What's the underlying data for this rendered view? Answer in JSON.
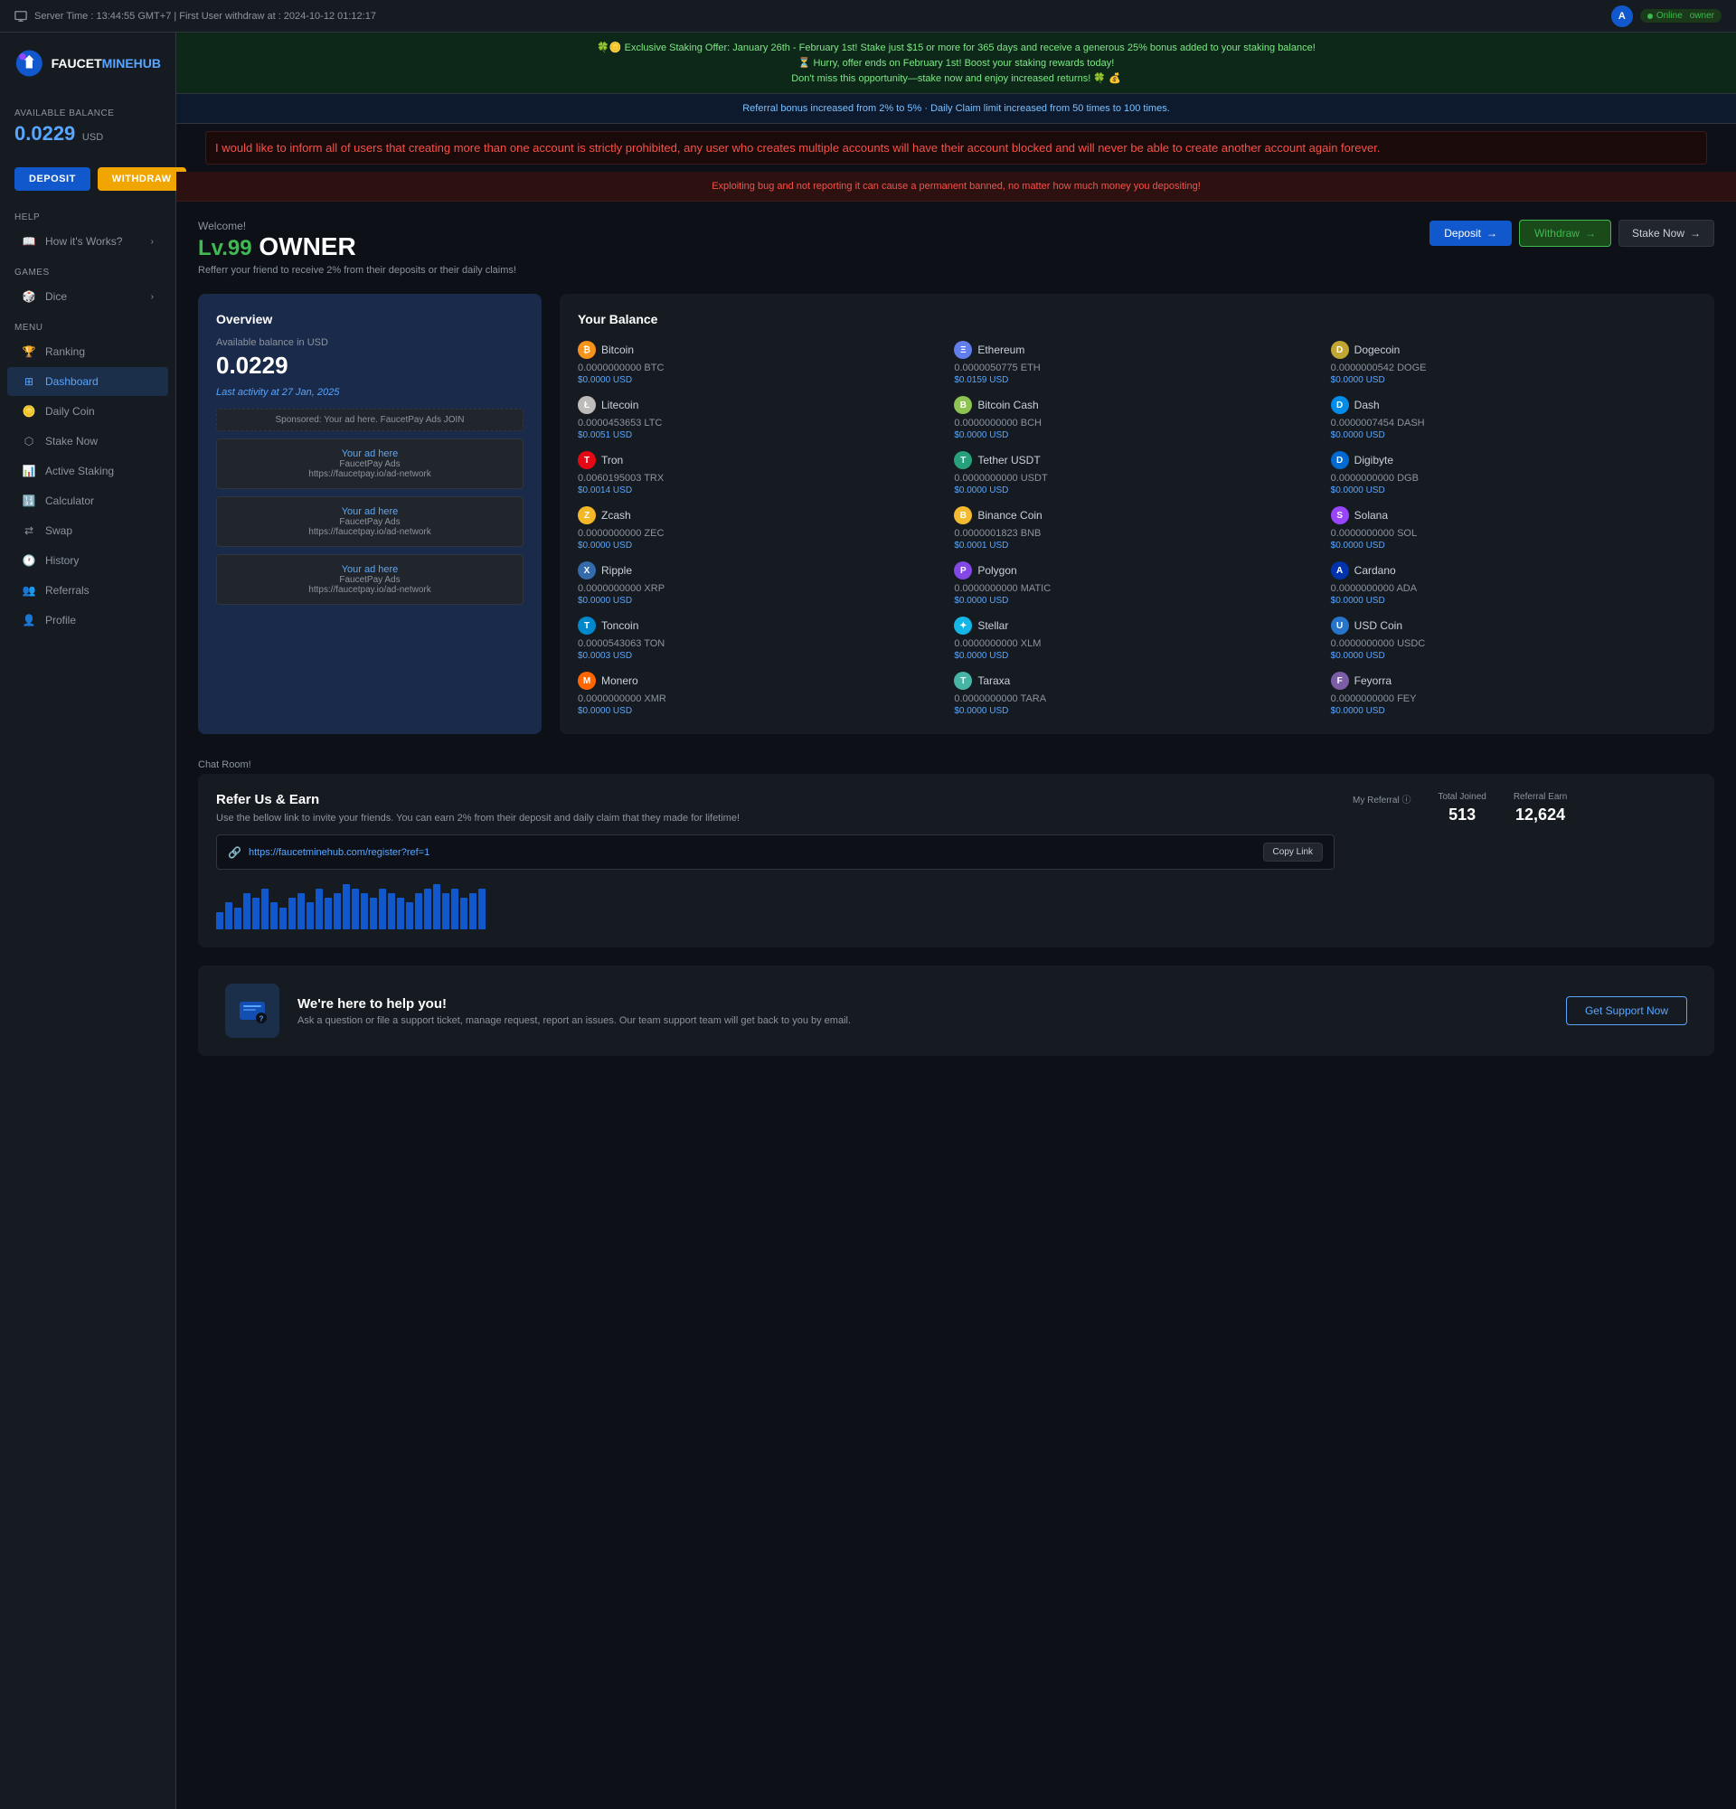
{
  "topbar": {
    "server_time": "Server Time : 13:44:55 GMT+7 | First User withdraw at : 2024-10-12 01:12:17",
    "online_label": "Online",
    "user_label": "owner",
    "avatar_letter": "A"
  },
  "sidebar": {
    "logo_text1": "FAUCET",
    "logo_text2": "MINEHUB",
    "balance_label": "AVAILABLE BALANCE",
    "balance_amount": "0.0229",
    "balance_currency": "USD",
    "btn_deposit": "DEPOSIT",
    "btn_withdraw": "WITHDRAW",
    "help_label": "HELP",
    "games_label": "GAMES",
    "menu_label": "MENU",
    "items": [
      {
        "id": "how-it-works",
        "label": "How it's Works?",
        "icon": "book",
        "section": "help",
        "has_chevron": true
      },
      {
        "id": "dice",
        "label": "Dice",
        "icon": "dice",
        "section": "games",
        "has_chevron": true
      },
      {
        "id": "ranking",
        "label": "Ranking",
        "icon": "trophy",
        "section": "menu"
      },
      {
        "id": "dashboard",
        "label": "Dashboard",
        "icon": "grid",
        "section": "menu",
        "active": true
      },
      {
        "id": "daily-coin",
        "label": "Daily Coin",
        "icon": "coins",
        "section": "menu"
      },
      {
        "id": "stake-now",
        "label": "Stake Now",
        "icon": "layers",
        "section": "menu"
      },
      {
        "id": "active-staking",
        "label": "Active Staking",
        "icon": "chart-bar",
        "section": "menu"
      },
      {
        "id": "calculator",
        "label": "Calculator",
        "icon": "calculator",
        "section": "menu"
      },
      {
        "id": "swap",
        "label": "Swap",
        "icon": "swap",
        "section": "menu"
      },
      {
        "id": "history",
        "label": "History",
        "icon": "clock",
        "section": "menu"
      },
      {
        "id": "referrals",
        "label": "Referrals",
        "icon": "users",
        "section": "menu"
      },
      {
        "id": "profile",
        "label": "Profile",
        "icon": "user",
        "section": "menu"
      }
    ]
  },
  "banners": {
    "staking_offer": "🍀🪙 Exclusive Staking Offer: January 26th - February 1st! Stake just $15 or more for 365 days and receive a generous 25% bonus added to your staking balance!",
    "staking_hurry": "⏳ Hurry, offer ends on February 1st! Boost your staking rewards today!",
    "staking_miss": "Don't miss this opportunity—stake now and enjoy increased returns! 🍀 💰",
    "referral_info": "Referral bonus increased from 2% to 5% · Daily Claim limit increased from 50 times to 100 times.",
    "multi_account_warning": "I would like to inform all of users that creating more than one account is strictly prohibited, any user who creates multiple accounts will have their account blocked and will never be able to create another account again forever.",
    "exploit_warning": "Exploiting bug and not reporting it can cause a permanent banned, no matter how much money you depositing!"
  },
  "welcome": {
    "text": "Welcome!",
    "level": "Lv.99",
    "username": "OWNER",
    "referral_info": "Refferr your friend to receive 2% from their deposits or their daily claims!",
    "btn_deposit": "Deposit",
    "btn_withdraw": "Withdraw",
    "btn_stake": "Stake Now"
  },
  "overview": {
    "title": "Overview",
    "balance_label": "Available balance in USD",
    "balance_value": "0.0229",
    "last_activity": "Last activity at 27 Jan, 2025",
    "ad_sponsored": "Sponsored: Your ad here. FaucetPay Ads  JOIN",
    "ads": [
      {
        "link": "Your ad here",
        "provider": "FaucetPay Ads",
        "url": "https://faucetpay.io/ad-network"
      },
      {
        "link": "Your ad here",
        "provider": "FaucetPay Ads",
        "url": "https://faucetpay.io/ad-network"
      },
      {
        "link": "Your ad here",
        "provider": "FaucetPay Ads",
        "url": "https://faucetpay.io/ad-network"
      }
    ]
  },
  "your_balance": {
    "title": "Your Balance",
    "coins": [
      {
        "name": "Bitcoin",
        "symbol": "BTC",
        "amount": "0.0000000000",
        "usd": "$0.0000 USD",
        "color": "btc",
        "letter": "₿"
      },
      {
        "name": "Ethereum",
        "symbol": "ETH",
        "amount": "0.0000050775",
        "usd": "$0.0159 USD",
        "color": "eth",
        "letter": "Ξ"
      },
      {
        "name": "Dogecoin",
        "symbol": "DOGE",
        "amount": "0.0000000542",
        "usd": "$0.0000 USD",
        "color": "doge",
        "letter": "D"
      },
      {
        "name": "Litecoin",
        "symbol": "LTC",
        "amount": "0.0000453653",
        "usd": "$0.0051 USD",
        "color": "ltc",
        "letter": "Ł"
      },
      {
        "name": "Bitcoin Cash",
        "symbol": "BCH",
        "amount": "0.0000000000",
        "usd": "$0.0000 USD",
        "color": "bch",
        "letter": "B"
      },
      {
        "name": "Dash",
        "symbol": "DASH",
        "amount": "0.0000007454",
        "usd": "$0.0000 USD",
        "color": "dash",
        "letter": "D"
      },
      {
        "name": "Tron",
        "symbol": "TRX",
        "amount": "0.0060195003",
        "usd": "$0.0014 USD",
        "color": "trx",
        "letter": "T"
      },
      {
        "name": "Tether USDT",
        "symbol": "USDT",
        "amount": "0.0000000000",
        "usd": "$0.0000 USD",
        "color": "usdt",
        "letter": "T"
      },
      {
        "name": "Digibyte",
        "symbol": "DGB",
        "amount": "0.0000000000",
        "usd": "$0.0000 USD",
        "color": "dgb",
        "letter": "D"
      },
      {
        "name": "Zcash",
        "symbol": "ZEC",
        "amount": "0.0000000000",
        "usd": "$0.0000 USD",
        "color": "zec",
        "letter": "Z"
      },
      {
        "name": "Binance Coin",
        "symbol": "BNB",
        "amount": "0.0000001823",
        "usd": "$0.0001 USD",
        "color": "bnb",
        "letter": "B"
      },
      {
        "name": "Solana",
        "symbol": "SOL",
        "amount": "0.0000000000",
        "usd": "$0.0000 USD",
        "color": "sol",
        "letter": "S"
      },
      {
        "name": "Ripple",
        "symbol": "XRP",
        "amount": "0.0000000000",
        "usd": "$0.0000 USD",
        "color": "xrp",
        "letter": "X"
      },
      {
        "name": "Polygon",
        "symbol": "MATIC",
        "amount": "0.0000000000",
        "usd": "$0.0000 USD",
        "color": "matic",
        "letter": "P"
      },
      {
        "name": "Cardano",
        "symbol": "ADA",
        "amount": "0.0000000000",
        "usd": "$0.0000 USD",
        "color": "ada",
        "letter": "A"
      },
      {
        "name": "Toncoin",
        "symbol": "TON",
        "amount": "0.0000543063",
        "usd": "$0.0003 USD",
        "color": "ton",
        "letter": "T"
      },
      {
        "name": "Stellar",
        "symbol": "XLM",
        "amount": "0.0000000000",
        "usd": "$0.0000 USD",
        "color": "xlm",
        "letter": "✦"
      },
      {
        "name": "USD Coin",
        "symbol": "USDC",
        "amount": "0.0000000000",
        "usd": "$0.0000 USD",
        "color": "usdc",
        "letter": "U"
      },
      {
        "name": "Monero",
        "symbol": "XMR",
        "amount": "0.0000000000",
        "usd": "$0.0000 USD",
        "color": "xmr",
        "letter": "M"
      },
      {
        "name": "Taraxa",
        "symbol": "TARA",
        "amount": "0.0000000000",
        "usd": "$0.0000 USD",
        "color": "tara",
        "letter": "T"
      },
      {
        "name": "Feyorra",
        "symbol": "FEY",
        "amount": "0.0000000000",
        "usd": "$0.0000 USD",
        "color": "fey",
        "letter": "F"
      }
    ]
  },
  "chat_room": {
    "label": "Chat Room!"
  },
  "referral": {
    "title": "Refer Us & Earn",
    "description": "Use the bellow link to invite your friends. You can earn 2% from their deposit and daily claim that they made for lifetime!",
    "link": "https://faucetminehub.com/register?ref=1",
    "btn_copy": "Copy Link",
    "my_referral_label": "My Referral ⓘ",
    "total_joined_label": "Total Joined",
    "total_joined_value": "513",
    "referral_earn_label": "Referral Earn",
    "referral_earn_value": "12,624",
    "chart_bars": [
      3,
      5,
      4,
      7,
      6,
      8,
      5,
      4,
      6,
      7,
      5,
      8,
      6,
      7,
      9,
      8,
      7,
      6,
      8,
      7,
      6,
      5,
      7,
      8,
      9,
      7,
      8,
      6,
      7,
      8
    ]
  },
  "support": {
    "title": "We're here to help you!",
    "description": "Ask a question or file a support ticket, manage request, report an issues. Our team support team will get back to you by email.",
    "btn_label": "Get Support Now"
  }
}
